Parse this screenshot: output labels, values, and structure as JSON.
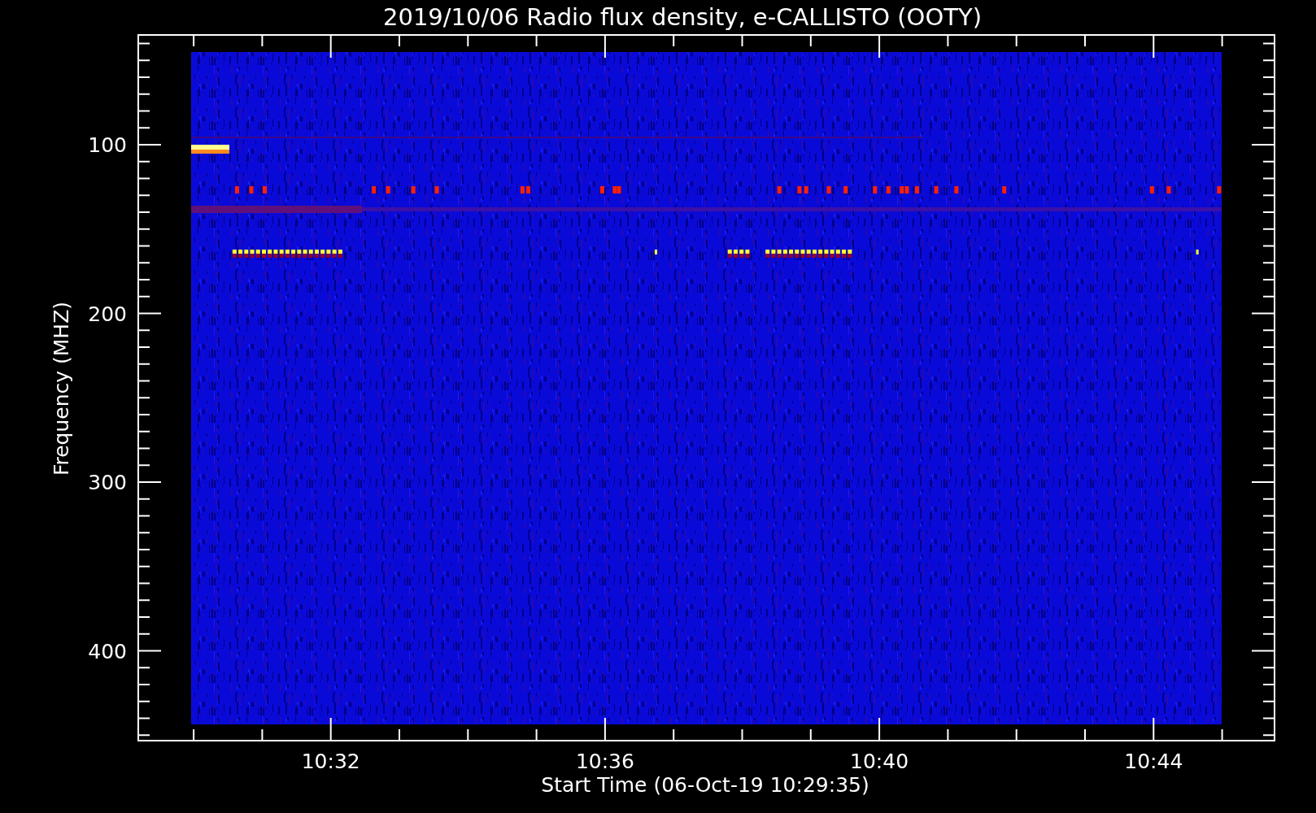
{
  "title": "2019/10/06  Radio flux density, e-CALLISTO (OOTY)",
  "ylabel": "Frequency (MHZ)",
  "xlabel": "Start Time (06-Oct-19 10:29:35)",
  "yticks": [
    "100",
    "200",
    "300",
    "400"
  ],
  "xticks": [
    "10:32",
    "10:36",
    "10:40",
    "10:44"
  ]
}
